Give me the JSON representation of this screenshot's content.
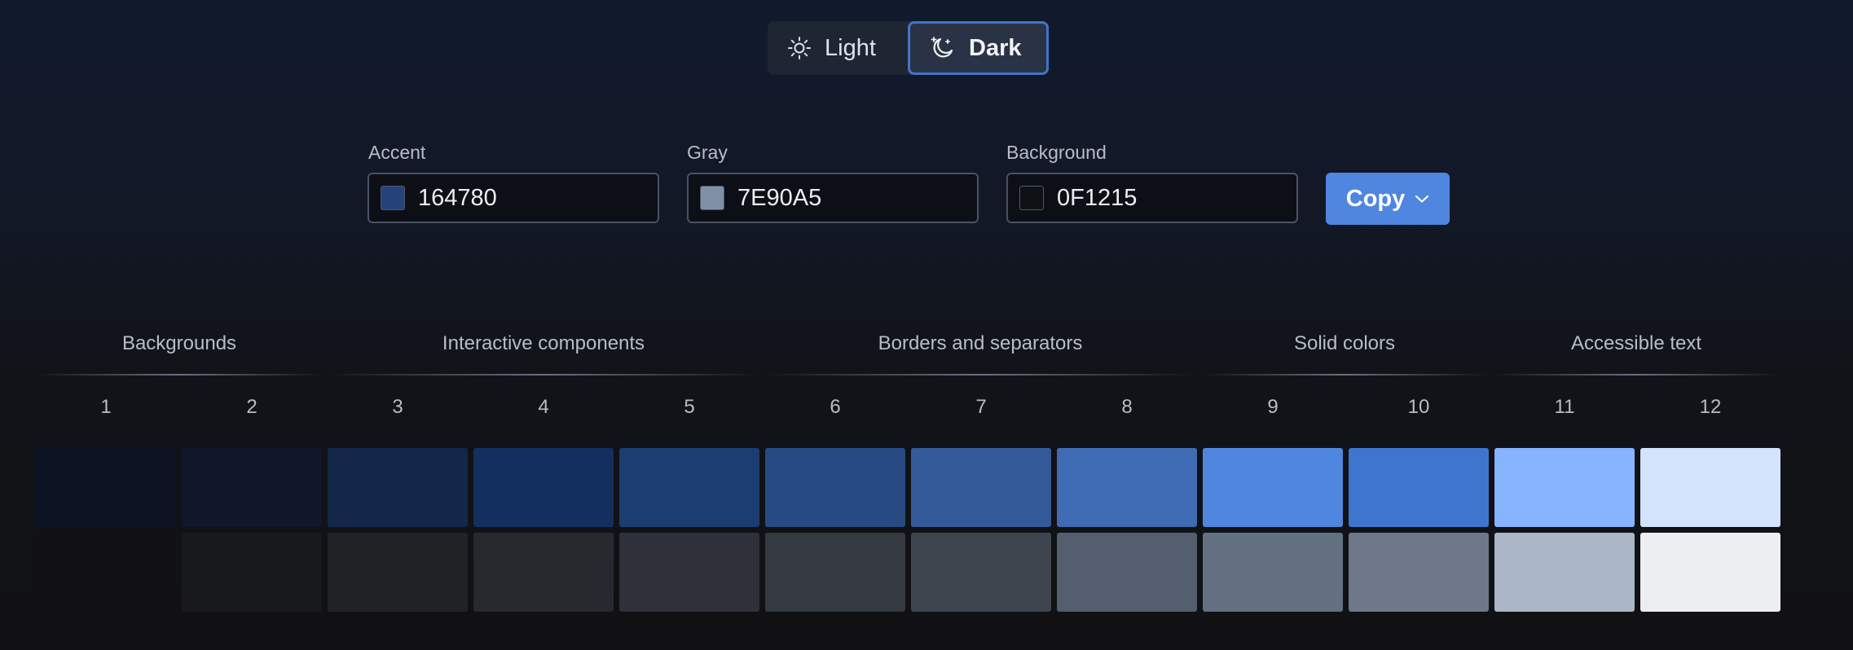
{
  "theme_toggle": {
    "light_label": "Light",
    "dark_label": "Dark",
    "selected": "Dark"
  },
  "fields": {
    "accent": {
      "label": "Accent",
      "value": "164780",
      "swatch": "#25437a"
    },
    "gray": {
      "label": "Gray",
      "value": "7E90A5",
      "swatch": "#7e90a5"
    },
    "background": {
      "label": "Background",
      "value": "0F1215",
      "swatch": "#0f1215"
    }
  },
  "copy_button": {
    "label": "Copy"
  },
  "groups": [
    "Backgrounds",
    "Interactive components",
    "Borders and separators",
    "Solid colors",
    "Accessible text"
  ],
  "steps": [
    "1",
    "2",
    "3",
    "4",
    "5",
    "6",
    "7",
    "8",
    "9",
    "10",
    "11",
    "12"
  ],
  "palette": {
    "accent": [
      "#0b1221",
      "#0f1728",
      "#14274a",
      "#132f5e",
      "#1c3d71",
      "#284a82",
      "#345a98",
      "#3f6bb5",
      "#4f86df",
      "#3e75cf",
      "#86b4ff",
      "#d4e3fc"
    ],
    "gray": [
      "#111113",
      "#17191a",
      "#212225",
      "#262a2f",
      "#2e3139",
      "#353940",
      "#3f454f",
      "#555e6e",
      "#627082",
      "#6e7889",
      "#abb6c6",
      "#eceef2"
    ]
  }
}
